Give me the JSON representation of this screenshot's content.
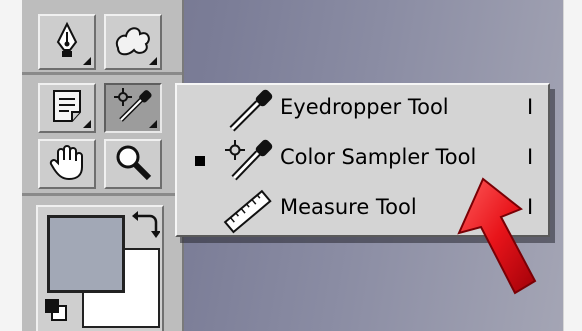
{
  "flyout": {
    "items": [
      {
        "label": "Eyedropper Tool",
        "shortcut": "I",
        "checked": false,
        "icon": "eyedropper-icon"
      },
      {
        "label": "Color Sampler Tool",
        "shortcut": "I",
        "checked": true,
        "icon": "color-sampler-icon"
      },
      {
        "label": "Measure Tool",
        "shortcut": "I",
        "checked": false,
        "icon": "ruler-icon"
      }
    ]
  },
  "toolbox": {
    "tools": [
      {
        "name": "pen-tool",
        "icon": "pen-nib-icon"
      },
      {
        "name": "custom-shape-tool",
        "icon": "shape-icon"
      },
      {
        "name": "notes-tool",
        "icon": "note-icon"
      },
      {
        "name": "eyedropper-tool",
        "icon": "color-sampler-icon",
        "active": true
      },
      {
        "name": "hand-tool",
        "icon": "hand-icon"
      },
      {
        "name": "zoom-tool",
        "icon": "magnifier-icon"
      }
    ]
  },
  "colors": {
    "foreground": "#a2a8b6",
    "background": "#ffffff",
    "arrow": "#e8141a"
  }
}
